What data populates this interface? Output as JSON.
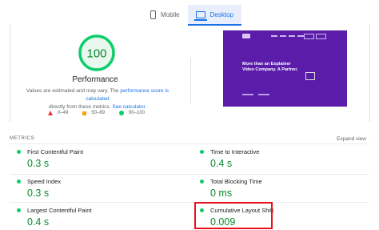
{
  "tabs": [
    {
      "label": "Mobile",
      "icon": "mobile-icon",
      "active": false
    },
    {
      "label": "Desktop",
      "icon": "desktop-icon",
      "active": true
    }
  ],
  "score": {
    "value": "100",
    "fraction": 1.0,
    "label": "Performance",
    "color": "#0cce6b",
    "note_prefix": "Values are estimated and may vary. The",
    "note_link1": "performance score is calculated",
    "note_middle": "directly from these metrics.",
    "note_link2": "See calculator."
  },
  "legend": [
    {
      "range": "0–49",
      "icon": "red-triangle-icon",
      "color": "#e53935"
    },
    {
      "range": "50–89",
      "icon": "orange-square-icon",
      "color": "#ffa400"
    },
    {
      "range": "90–100",
      "icon": "green-circle-icon",
      "color": "#0cce6b"
    }
  ],
  "screenshot": {
    "hero_text": "More than an Explainer Video Company. A Partner."
  },
  "metrics": {
    "heading": "METRICS",
    "expand": "Expand view",
    "items": [
      {
        "name": "First Contentful Paint",
        "value": "0.3 s"
      },
      {
        "name": "Time to Interactive",
        "value": "0.4 s"
      },
      {
        "name": "Speed Index",
        "value": "0.3 s"
      },
      {
        "name": "Total Blocking Time",
        "value": "0 ms"
      },
      {
        "name": "Largest Contentful Paint",
        "value": "0.4 s"
      },
      {
        "name": "Cumulative Layout Shift",
        "value": "0.009"
      }
    ]
  },
  "colors": {
    "good": "#0cce6b",
    "good_text": "#0a8a2e",
    "accent": "#1a73e8",
    "highlight": "#e8101c"
  }
}
